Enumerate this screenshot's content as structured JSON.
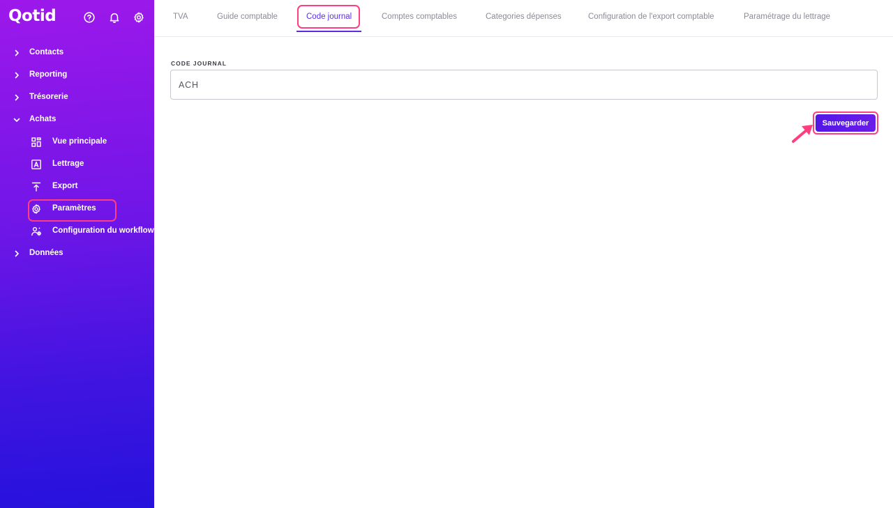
{
  "app": {
    "logo": "Qotid"
  },
  "header_icons": [
    {
      "name": "help-circle-icon"
    },
    {
      "name": "bell-icon"
    },
    {
      "name": "gear-icon"
    }
  ],
  "sidebar": {
    "items": [
      {
        "label": "Contacts",
        "expanded": false
      },
      {
        "label": "Reporting",
        "expanded": false
      },
      {
        "label": "Trésorerie",
        "expanded": false
      },
      {
        "label": "Achats",
        "expanded": true
      },
      {
        "label": "Données",
        "expanded": false
      }
    ],
    "achats_children": [
      {
        "label": "Vue principale",
        "icon": "grid-icon"
      },
      {
        "label": "Lettrage",
        "icon": "letter-a-icon"
      },
      {
        "label": "Export",
        "icon": "upload-icon"
      },
      {
        "label": "Paramètres",
        "icon": "gear-icon",
        "highlighted": true
      },
      {
        "label": "Configuration du workflow",
        "icon": "user-gear-icon"
      }
    ]
  },
  "tabs": [
    {
      "label": "TVA",
      "active": false
    },
    {
      "label": "Guide comptable",
      "active": false
    },
    {
      "label": "Code journal",
      "active": true
    },
    {
      "label": "Comptes comptables",
      "active": false
    },
    {
      "label": "Categories dépenses",
      "active": false
    },
    {
      "label": "Configuration de l'export comptable",
      "active": false
    },
    {
      "label": "Paramétrage du lettrage",
      "active": false
    }
  ],
  "form": {
    "field_label": "CODE JOURNAL",
    "field_value": "ACH",
    "save_label": "Sauvegarder"
  },
  "colors": {
    "accent": "#5a2ee0",
    "highlight": "#ff3d7f",
    "sidebar_top": "#9d18ea",
    "sidebar_bottom": "#2512dc"
  }
}
